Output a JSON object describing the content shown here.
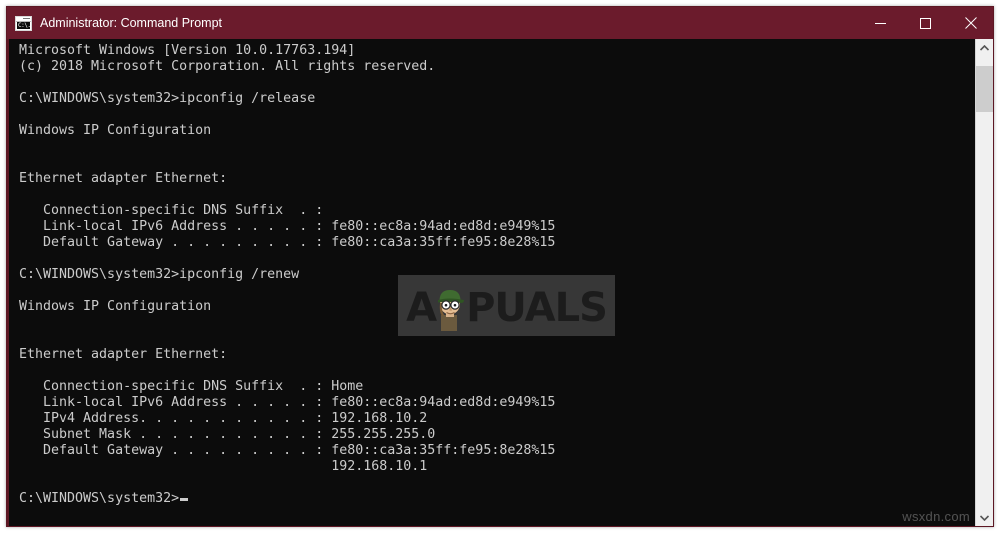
{
  "window": {
    "title": "Administrator: Command Prompt",
    "icon": "command-prompt-icon",
    "icon_glyph": "C:\\.",
    "titlebar_color": "#6b1b2c",
    "console_bg": "#0c0c0c",
    "console_fg": "#cccccc",
    "controls": {
      "minimize_label": "Minimize",
      "maximize_label": "Maximize",
      "close_label": "Close"
    }
  },
  "scrollbar": {
    "up_arrow": "scroll-up-arrow",
    "down_arrow": "scroll-down-arrow",
    "thumb": "scroll-thumb"
  },
  "console": {
    "text": "Microsoft Windows [Version 10.0.17763.194]\n(c) 2018 Microsoft Corporation. All rights reserved.\n\nC:\\WINDOWS\\system32>ipconfig /release\n\nWindows IP Configuration\n\n\nEthernet adapter Ethernet:\n\n   Connection-specific DNS Suffix  . :\n   Link-local IPv6 Address . . . . . : fe80::ec8a:94ad:ed8d:e949%15\n   Default Gateway . . . . . . . . . : fe80::ca3a:35ff:fe95:8e28%15\n\nC:\\WINDOWS\\system32>ipconfig /renew\n\nWindows IP Configuration\n\n\nEthernet adapter Ethernet:\n\n   Connection-specific DNS Suffix  . : Home\n   Link-local IPv6 Address . . . . . : fe80::ec8a:94ad:ed8d:e949%15\n   IPv4 Address. . . . . . . . . . . : 192.168.10.2\n   Subnet Mask . . . . . . . . . . . : 255.255.255.0\n   Default Gateway . . . . . . . . . : fe80::ca3a:35ff:fe95:8e28%15\n                                       192.168.10.1\n\n",
    "prompt": "C:\\WINDOWS\\system32>",
    "commands": [
      "ipconfig /release",
      "ipconfig /renew"
    ],
    "release_output": {
      "header": "Windows IP Configuration",
      "adapter": "Ethernet adapter Ethernet:",
      "connection_specific_dns_suffix": "",
      "link_local_ipv6_address": "fe80::ec8a:94ad:ed8d:e949%15",
      "default_gateway": "fe80::ca3a:35ff:fe95:8e28%15"
    },
    "renew_output": {
      "header": "Windows IP Configuration",
      "adapter": "Ethernet adapter Ethernet:",
      "connection_specific_dns_suffix": "Home",
      "link_local_ipv6_address": "fe80::ec8a:94ad:ed8d:e949%15",
      "ipv4_address": "192.168.10.2",
      "subnet_mask": "255.255.255.0",
      "default_gateway": "fe80::ca3a:35ff:fe95:8e28%15",
      "default_gateway_secondary": "192.168.10.1"
    },
    "version_line": "Microsoft Windows [Version 10.0.17763.194]",
    "copyright_line": "(c) 2018 Microsoft Corporation. All rights reserved."
  },
  "watermarks": {
    "logo_prefix": "A",
    "logo_suffix": "PUALS",
    "bottom_text": "wsxdn.com"
  }
}
